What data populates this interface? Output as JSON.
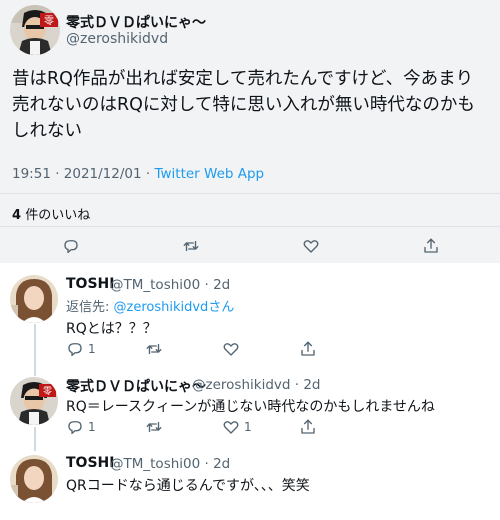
{
  "main_tweet": {
    "display_name": "零式ＤＶＤぱいにゃ〜",
    "handle": "@zeroshikidvd",
    "text": "昔はRQ作品が出れば安定して売れたんですけど、今あまり売れないのはRQに対して特に思い入れが無い時代なのかもしれない",
    "time": "19:51 · 2021/12/01 · ",
    "source": "Twitter Web App",
    "likes_count": "4",
    "likes_label": "件のいいね",
    "icons": [
      "reply-icon",
      "retweet-icon",
      "like-icon",
      "share-icon"
    ]
  },
  "replies": [
    {
      "display_name": "TOSHI",
      "handle": "@TM_toshi00 · 2d",
      "replying_prefix": "返信先: ",
      "replying_to": "@zeroshikidvd",
      "replying_suffix": "さん",
      "text": "RQとは？？？",
      "reply_count": "1",
      "like_count": ""
    },
    {
      "display_name": "零式ＤＶＤぱいにゃ〜",
      "handle": "@zeroshikidvd · 2d",
      "text": "RQ＝レースクィーンが通じない時代なのかもしれませんね",
      "reply_count": "1",
      "like_count": "1"
    },
    {
      "display_name": "TOSHI",
      "handle": "@TM_toshi00 · 2d",
      "text": "QRコードなら通じるんですが、、、笑笑"
    }
  ],
  "colors": {
    "accent": "#1d9bf0",
    "secondary_text": "#536471",
    "main_bg": "#f2f3f5"
  }
}
